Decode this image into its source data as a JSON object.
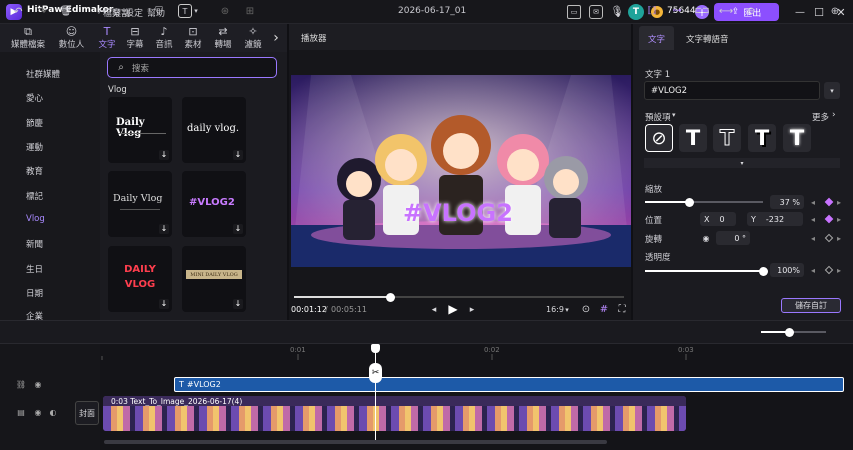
{
  "app": {
    "name": "HitPaw Edimakor",
    "menus": [
      "檔案",
      "設定",
      "幫助"
    ],
    "project": "2026-06-17_01",
    "credits": "75644",
    "avatar": "T",
    "export_label": "匯出"
  },
  "categories": [
    {
      "label": "媒體檔案",
      "icon": "media-icon"
    },
    {
      "label": "數位人",
      "icon": "avatar-icon"
    },
    {
      "label": "文字",
      "icon": "text-icon"
    },
    {
      "label": "字幕",
      "icon": "subtitle-icon"
    },
    {
      "label": "音訊",
      "icon": "audio-icon"
    },
    {
      "label": "素材",
      "icon": "sticker-icon"
    },
    {
      "label": "轉場",
      "icon": "transition-icon"
    },
    {
      "label": "濾鏡",
      "icon": "filter-icon"
    }
  ],
  "sidebar": [
    "社群媒體",
    "愛心",
    "節慶",
    "運動",
    "教育",
    "標記",
    "Vlog",
    "新聞",
    "生日",
    "日期",
    "企業"
  ],
  "search": {
    "placeholder": "搜索"
  },
  "section": "Vlog",
  "templates": [
    "Daily Vlog",
    "daily vlog.",
    "Daily Vlog",
    "#VLOG2",
    "DAILY VLOG",
    "MINI DAILY VLOG"
  ],
  "player": {
    "title": "播放器",
    "overlay_text": "#VLOG2",
    "time_current": "00:01:12",
    "time_total": "00:05:11",
    "ratio": "16:9",
    "progress": 0.29
  },
  "props": {
    "tabs": [
      "文字",
      "文字轉語音"
    ],
    "text_label": "文字 1",
    "text_value": "#VLOG2",
    "preset_label": "預設項",
    "more_label": "更多",
    "scale_label": "縮放",
    "scale_value": "37 %",
    "scale_fraction": 0.37,
    "pos_label": "位置",
    "pos_x_label": "X",
    "pos_x": "0",
    "pos_y_label": "Y",
    "pos_y": "-232",
    "rotate_label": "旋轉",
    "rotate_value": "0 °",
    "opacity_label": "透明度",
    "opacity_value": "100%",
    "opacity_fraction": 1.0,
    "save_custom": "儲存自訂"
  },
  "toolbar": {
    "split_label": "分割"
  },
  "timeline": {
    "ticks": [
      "0:01",
      "0:02",
      "0:03"
    ],
    "text_clip": "#VLOG2",
    "video_clip": "0:03  Text_To_Image_2026-06-17(4)",
    "cover_label": "封面"
  }
}
